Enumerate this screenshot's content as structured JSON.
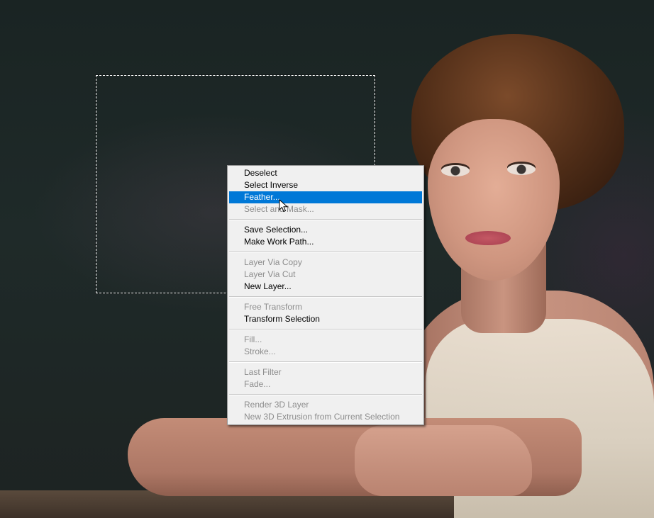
{
  "context_menu": {
    "groups": [
      {
        "items": [
          {
            "label": "Deselect",
            "enabled": true,
            "highlighted": false
          },
          {
            "label": "Select Inverse",
            "enabled": true,
            "highlighted": false
          },
          {
            "label": "Feather...",
            "enabled": true,
            "highlighted": true
          },
          {
            "label": "Select and Mask...",
            "enabled": false,
            "highlighted": false
          }
        ]
      },
      {
        "items": [
          {
            "label": "Save Selection...",
            "enabled": true,
            "highlighted": false
          },
          {
            "label": "Make Work Path...",
            "enabled": true,
            "highlighted": false
          }
        ]
      },
      {
        "items": [
          {
            "label": "Layer Via Copy",
            "enabled": false,
            "highlighted": false
          },
          {
            "label": "Layer Via Cut",
            "enabled": false,
            "highlighted": false
          },
          {
            "label": "New Layer...",
            "enabled": true,
            "highlighted": false
          }
        ]
      },
      {
        "items": [
          {
            "label": "Free Transform",
            "enabled": false,
            "highlighted": false
          },
          {
            "label": "Transform Selection",
            "enabled": true,
            "highlighted": false
          }
        ]
      },
      {
        "items": [
          {
            "label": "Fill...",
            "enabled": false,
            "highlighted": false
          },
          {
            "label": "Stroke...",
            "enabled": false,
            "highlighted": false
          }
        ]
      },
      {
        "items": [
          {
            "label": "Last Filter",
            "enabled": false,
            "highlighted": false
          },
          {
            "label": "Fade...",
            "enabled": false,
            "highlighted": false
          }
        ]
      },
      {
        "items": [
          {
            "label": "Render 3D Layer",
            "enabled": false,
            "highlighted": false
          },
          {
            "label": "New 3D Extrusion from Current Selection",
            "enabled": false,
            "highlighted": false
          }
        ]
      }
    ]
  },
  "colors": {
    "highlight": "#0078d7",
    "menu_background": "#f0f0f0",
    "disabled_text": "#8d8d8d"
  },
  "icons": {
    "cursor": "arrow-cursor-icon"
  }
}
